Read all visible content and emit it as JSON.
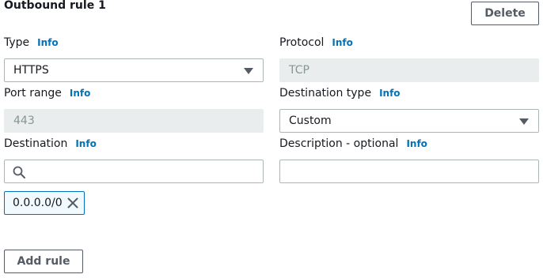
{
  "rule": {
    "title": "Outbound rule 1",
    "delete_label": "Delete"
  },
  "info_label": "Info",
  "type": {
    "label": "Type",
    "value": "HTTPS"
  },
  "protocol": {
    "label": "Protocol",
    "value": "TCP"
  },
  "port_range": {
    "label": "Port range",
    "value": "443"
  },
  "destination_type": {
    "label": "Destination type",
    "value": "Custom"
  },
  "destination": {
    "label": "Destination",
    "value": "",
    "token": "0.0.0.0/0"
  },
  "description": {
    "label": "Description - optional",
    "value": ""
  },
  "add_rule_label": "Add rule",
  "icons": {
    "caret": "caret-down-icon",
    "search": "search-icon",
    "remove": "close-icon"
  },
  "colors": {
    "link": "#0073bb",
    "text": "#16191f",
    "border": "#aab7b8",
    "disabled_bg": "#eaeded",
    "token_bg": "#f1faff"
  }
}
